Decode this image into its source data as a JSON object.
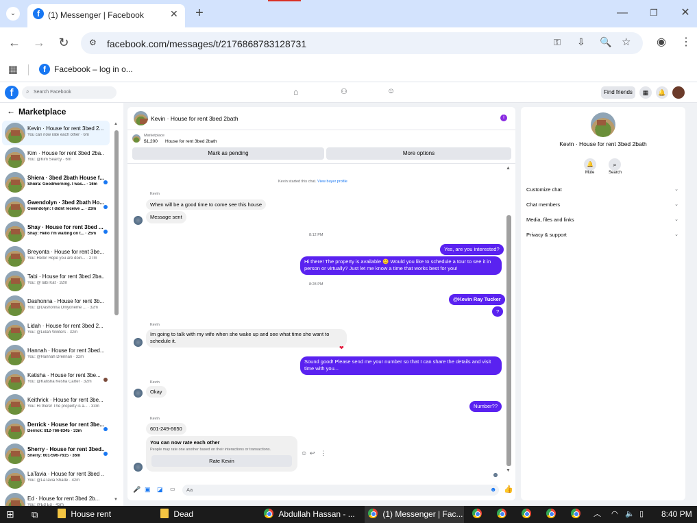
{
  "browser": {
    "tab_title": "(1) Messenger | Facebook",
    "new_tab": "+",
    "url": "facebook.com/messages/t/2176868783128731",
    "bookmark": "Facebook – log in o..."
  },
  "fb": {
    "search_placeholder": "Search Facebook",
    "find_friends": "Find friends"
  },
  "left": {
    "heading": "Marketplace",
    "conversations": [
      {
        "title": "Kevin · House for rent 3bed 2...",
        "sub": "You can now rate each other · 6m"
      },
      {
        "title": "Kim · House for rent 3bed 2ba...",
        "sub": "You: @Kim Searcy · 6m"
      },
      {
        "title": "Shiera · 3bed 2bath House f...",
        "sub": "Shiera: Goodmorning. I was...  · 16m"
      },
      {
        "title": "Gwendolyn · 3bed 2bath Ho...",
        "sub": "Gwendolyn: I didnt receive ... · 23m"
      },
      {
        "title": "Shay · House for rent 3bed ...",
        "sub": "Shay: Hello I'm waiting on t...  · 25m"
      },
      {
        "title": "Breyonta · House for rent 3be...",
        "sub": "You: Hello! Hope you are doin... · 27m"
      },
      {
        "title": "Tabi · House for rent 3bed 2ba...",
        "sub": "You: @Tabi Kat · 32m"
      },
      {
        "title": "Dashonna · House for rent 3b...",
        "sub": "You: @Dashonna Onlyoneme ... · 32m"
      },
      {
        "title": "Lidah · House for rent 3bed 2...",
        "sub": "You: @Lidah Winters · 32m"
      },
      {
        "title": "Hannah · House for rent 3bed...",
        "sub": "You: @Hannah Drennan · 32m"
      },
      {
        "title": "Katisha · House for rent 3be...",
        "sub": "You: @Katisha Kesha Carter · 32m"
      },
      {
        "title": "Keithrick · House for rent 3be...",
        "sub": "You: Hi there! The property is a... · 33m"
      },
      {
        "title": "Derrick · House for rent 3be...",
        "sub": "Derrick: 812-766-8345 · 33m"
      },
      {
        "title": "Sherry · House for rent 3bed...",
        "sub": "Sherry: 601-596-7615 · 36m"
      },
      {
        "title": "LaTavia · House for rent 3bed ...",
        "sub": "You: @LaTavia Shade · 42m"
      },
      {
        "title": "Ed · House for rent 3bed 2b...",
        "sub": "You: @Ed Eq · 43m"
      }
    ]
  },
  "chat": {
    "header": "Kevin · House for rent 3bed 2bath",
    "listing_label": "Marketplace",
    "listing_price": "$1,200",
    "listing_title": "House for rent 3bed 2bath",
    "mark_pending": "Mark as pending",
    "more_options": "More options",
    "started_text": "Kevin started this chat.",
    "view_profile": "View buyer profile",
    "sender_name": "Kevin",
    "msg1": "When will be a good time to come see this house",
    "msg2": "Message sent",
    "time1": "8:12 PM",
    "out1": "Yes, are you interested?",
    "out2a": "Hi there! The property is available 😊 Would you like to schedule a tour to see it in",
    "out2b": "person or virtually? Just let me know a time that works best for you!",
    "time2": "8:28 PM",
    "out3": "@Kevin Ray Tucker",
    "out4": "?",
    "msg3a": "Im going to talk with my wife when she wake up and see what time she want to",
    "msg3b": "schedule it.",
    "reaction": "❤",
    "out5a": "Sound good! Please send me your number so that I can share the details and visit",
    "out5b": "time with you...",
    "msg4": "Okay",
    "out6": "Number??",
    "msg5": "601-249-6650",
    "rate_title": "You can now rate each other",
    "rate_sub": "People may rate one another based on their interactions or transactions.",
    "rate_button": "Rate Kevin",
    "composer_placeholder": "Aa"
  },
  "right": {
    "title": "Kevin · House for rent 3bed 2bath",
    "mute": "Mute",
    "search": "Search",
    "rows": [
      "Customize chat",
      "Chat members",
      "Media, files and links",
      "Privacy & support"
    ]
  },
  "taskbar": {
    "items": [
      "House rent",
      "Dead",
      "Abdullah Hassan - ...",
      "(1) Messenger | Fac..."
    ],
    "clock": "8:40 PM"
  },
  "colors": {
    "fb_blue": "#1877f2",
    "outgoing": "#5a22f0"
  }
}
